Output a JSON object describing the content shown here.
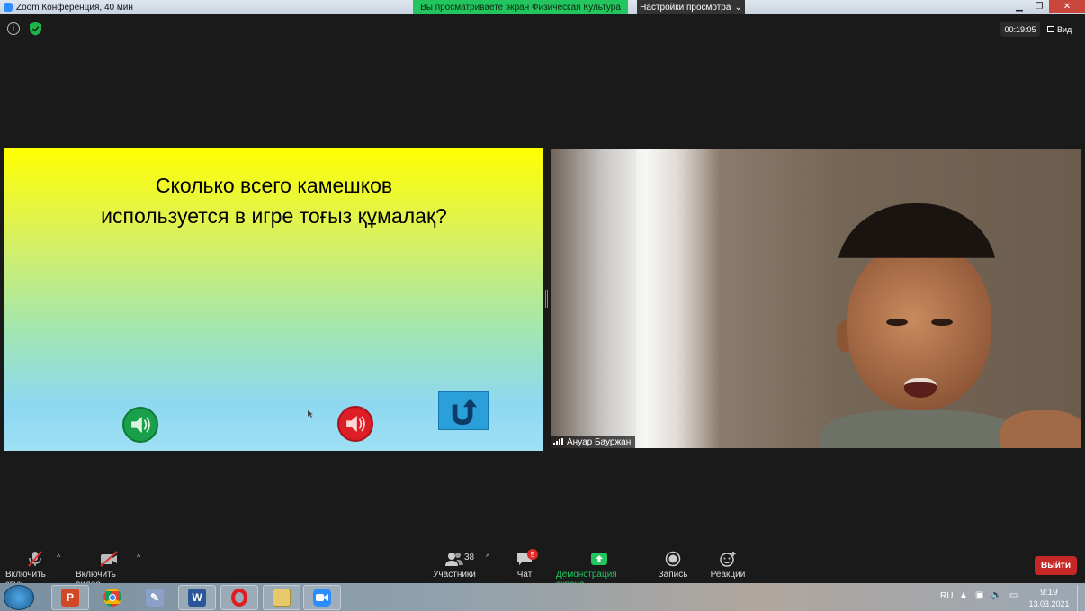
{
  "window": {
    "title": "Zoom Конференция, 40 мин",
    "share_banner": "Вы просматриваете экран Физическая Культура",
    "view_options": "Настройки просмотра"
  },
  "meeting": {
    "timer": "00:19:05",
    "view_label": "Вид"
  },
  "slide": {
    "question_line1": "Сколько всего камешков",
    "question_line2": "используется в игре тоғыз құмалақ?"
  },
  "video": {
    "participant_name": "Ануар Бауржан"
  },
  "toolbar": {
    "audio_label": "Включить звук",
    "video_label": "Включить видео",
    "participants_label": "Участники",
    "participants_count": "38",
    "chat_label": "Чат",
    "chat_badge": "5",
    "share_label": "Демонстрация экрана",
    "record_label": "Запись",
    "reactions_label": "Реакции",
    "leave_label": "Выйти"
  },
  "taskbar": {
    "apps": [
      "powerpoint",
      "chrome",
      "paint",
      "word",
      "opera",
      "explorer",
      "zoom"
    ],
    "language": "RU",
    "time": "9:19",
    "date": "13.03.2021"
  },
  "colors": {
    "share_green": "#22c55e",
    "leave_red": "#c62828",
    "slide_top": "#ffff00",
    "slide_bottom": "#9fe0f4"
  }
}
